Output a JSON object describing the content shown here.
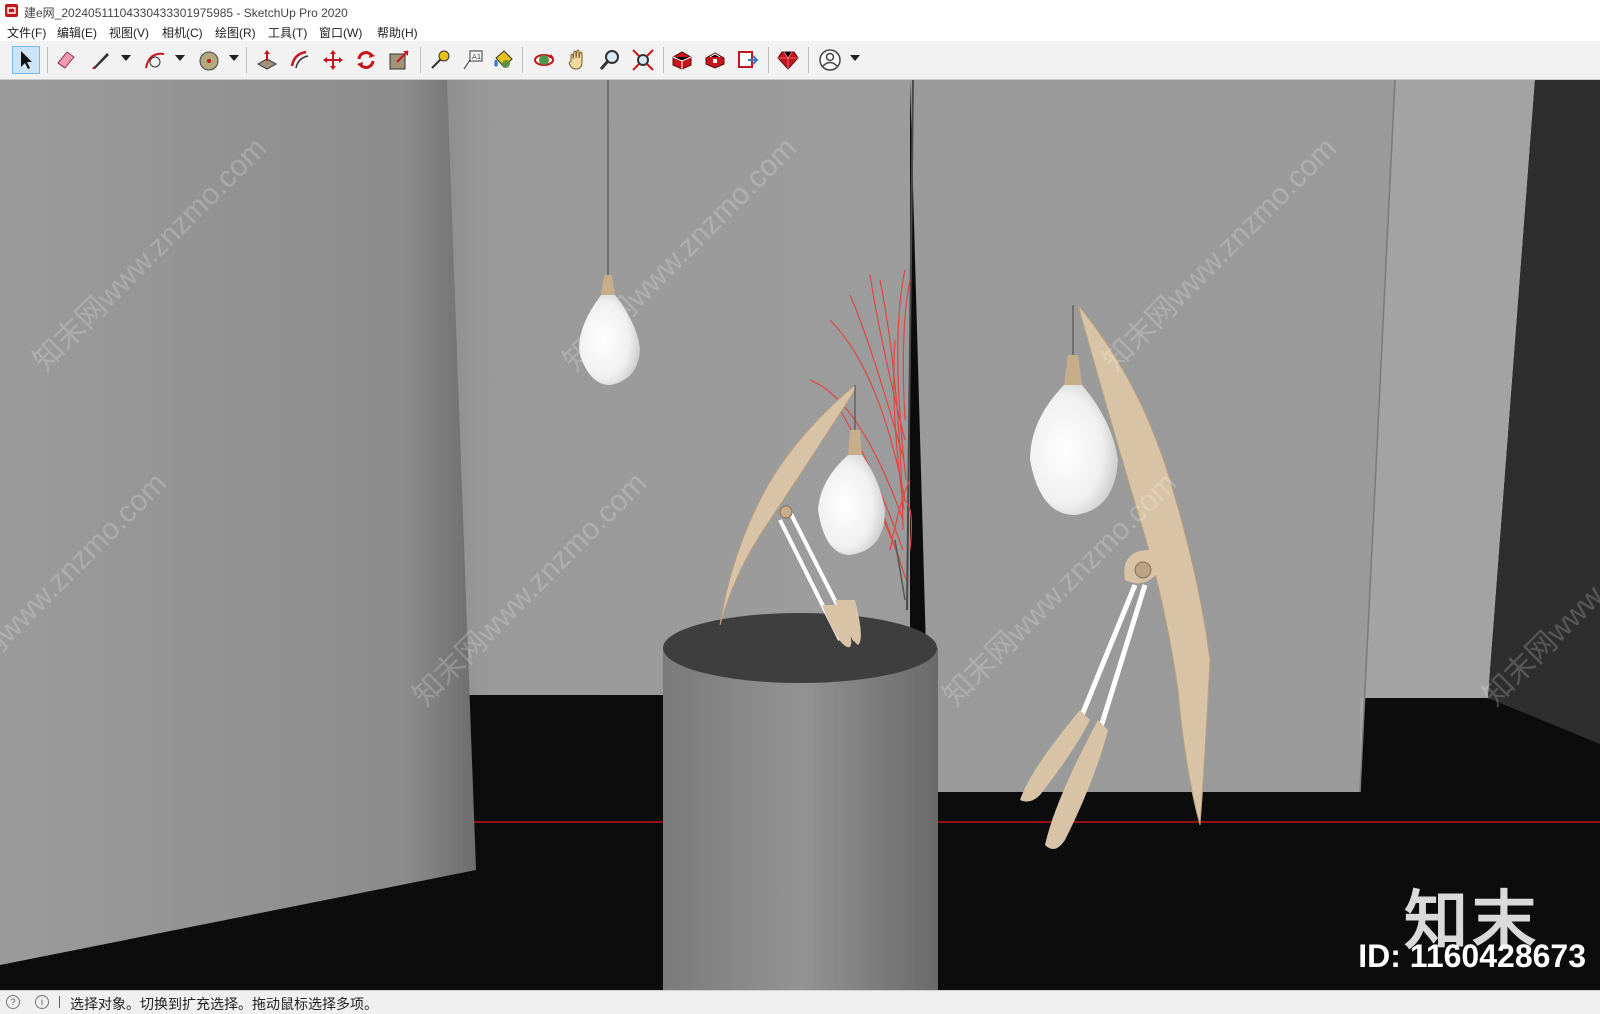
{
  "window": {
    "title": "建e网_20240511104330433301975985 - SketchUp Pro 2020"
  },
  "menu": [
    {
      "id": "file",
      "label": "文件(F)"
    },
    {
      "id": "edit",
      "label": "编辑(E)"
    },
    {
      "id": "view",
      "label": "视图(V)"
    },
    {
      "id": "camera",
      "label": "相机(C)"
    },
    {
      "id": "draw",
      "label": "绘图(R)"
    },
    {
      "id": "tools",
      "label": "工具(T)"
    },
    {
      "id": "window",
      "label": "窗口(W)"
    },
    {
      "id": "help",
      "label": "帮助(H)"
    }
  ],
  "toolbar": [
    {
      "icon": "select-arrow-icon",
      "active": true
    },
    {
      "icon": "eraser-icon"
    },
    {
      "icon": "pencil-line-icon",
      "dropdown": true
    },
    {
      "icon": "arc-icon",
      "dropdown": true
    },
    {
      "icon": "circle-icon",
      "dropdown": true
    },
    {
      "icon": "push-pull-icon"
    },
    {
      "icon": "offset-icon"
    },
    {
      "icon": "move-icon"
    },
    {
      "icon": "rotate-icon"
    },
    {
      "icon": "scale-icon"
    },
    {
      "icon": "tape-measure-icon"
    },
    {
      "icon": "text-label-icon"
    },
    {
      "icon": "paint-bucket-icon"
    },
    {
      "icon": "orbit-icon"
    },
    {
      "icon": "pan-hand-icon"
    },
    {
      "icon": "zoom-icon"
    },
    {
      "icon": "zoom-extents-icon"
    },
    {
      "icon": "warehouse-icon"
    },
    {
      "icon": "extension-warehouse-icon"
    },
    {
      "icon": "layout-send-icon"
    },
    {
      "icon": "ruby-console-icon"
    },
    {
      "icon": "user-account-icon",
      "dropdown": true
    }
  ],
  "viewport": {
    "watermark_text": "知末网www.znzmo.com",
    "brand_text": "知末",
    "id_text": "ID: 1160428673"
  },
  "statusbar": {
    "message": "选择对象。切换到扩充选择。拖动鼠标选择多项。"
  },
  "colors": {
    "wall": "#9a9a9a",
    "floor": "#0c0c0c",
    "pedestal": "#8a8a8a",
    "wood": "#d9c3a6",
    "plant": "#e0463f",
    "axis_red": "#c0141c"
  }
}
